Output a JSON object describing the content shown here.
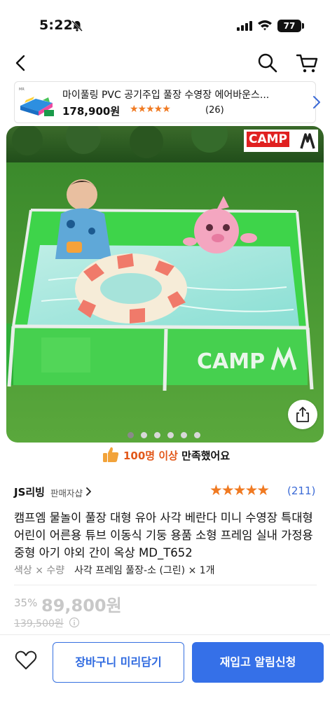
{
  "status_bar": {
    "time": "5:22",
    "battery": "77"
  },
  "nav": {
    "back_icon": "chevron-left-icon",
    "search_icon": "search-icon",
    "cart_icon": "cart-icon"
  },
  "promo": {
    "title": "마이풀링 PVC 공기주입 풀장 수영장 에어바운스...",
    "price": "178,900원",
    "stars": "★★★★★",
    "review_count": "(26)"
  },
  "hero": {
    "badge_text": "CAMP",
    "pool_brand": "CAMP",
    "image_count": 6,
    "active_index": 0
  },
  "satisfaction": {
    "highlight": "100명 이상",
    "rest": " 만족했어요"
  },
  "product": {
    "seller": "JS리빙",
    "seller_badge": "판매자샵",
    "rating_stars": "★★★★★",
    "rating": 4.5,
    "review_count": "(211)",
    "title": "캠프엠 물놀이 풀장 대형 유아 사각 베란다 미니 수영장 특대형 어린이 어른용 튜브 이동식 기둥 용품 소형 프레임 실내 가정용 중형 아기 야외 간이 옥상 MD_T652",
    "option_label": "색상 × 수량",
    "option_value": "사각 프레임 풀장-소 (그린) × 1개",
    "discount": "35%",
    "price": "89,800원",
    "original_price": "139,500원"
  },
  "bottom": {
    "cart_label": "장바구니 미리담기",
    "notify_label": "재입고 알림신청"
  },
  "colors": {
    "accent_blue": "#3570e8",
    "star_orange": "#f07a22",
    "highlight_orange": "#e2581a"
  }
}
